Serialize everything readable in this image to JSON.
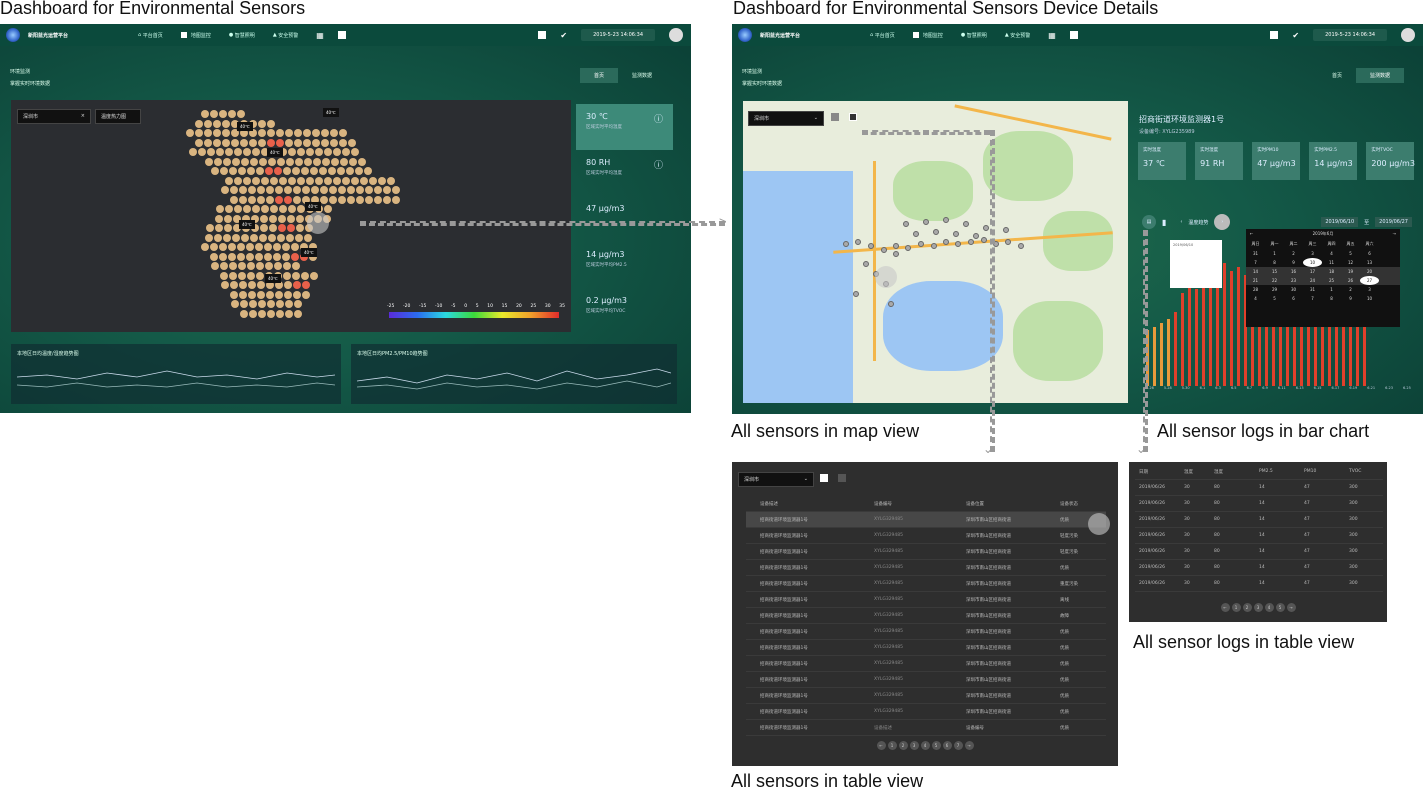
{
  "captions": {
    "dash_main": "Dashboard for Environmental Sensors",
    "dash_details": "Dashboard for Environmental Sensors Device Details",
    "map_view": "All sensors in map view",
    "bar_chart": "All sensor logs in bar chart",
    "table_view": "All sensors in table view",
    "logs_table": "All sensor logs in table view"
  },
  "topbar": {
    "brand": "新阳蓝光运营平台",
    "nav": [
      "平台首页",
      "地图监控",
      "智慧照明",
      "安全预警"
    ],
    "date": "2019-5-23 14:06:34"
  },
  "left": {
    "title": "环境监测",
    "subtitle": "掌握实时环境数据",
    "tabs": [
      "首页",
      "监测数据"
    ],
    "city": "深圳市",
    "layer": "温度热力图",
    "tags": [
      "40℃",
      "40℃",
      "40℃",
      "40℃",
      "40℃",
      "40℃",
      "40℃"
    ],
    "stats": [
      {
        "value": "30 ℃",
        "label": "区域实时平均温度"
      },
      {
        "value": "80 RH",
        "label": "区域实时平均湿度"
      },
      {
        "value": "47 μg/m3",
        "label": ""
      },
      {
        "value": "14 μg/m3",
        "label": "区域实时平均PM2.5"
      },
      {
        "value": "0.2 μg/m3",
        "label": "区域实时平均TVOC"
      }
    ],
    "scale": [
      "-25",
      "-20",
      "-15",
      "-10",
      "-5",
      "0",
      "5",
      "10",
      "15",
      "20",
      "25",
      "30",
      "35"
    ],
    "charts": [
      "本地区日均温度/湿度趋势图",
      "本地区日均PM2.5/PM10趋势图"
    ]
  },
  "right": {
    "tabs": [
      "首页",
      "监测数据"
    ],
    "city": "深圳市",
    "device_name": "招商街道环境监测器1号",
    "device_id": "设备编号: XYLG235989",
    "cards": [
      {
        "label": "实时温度",
        "value": "37 ℃"
      },
      {
        "label": "实时湿度",
        "value": "91 RH"
      },
      {
        "label": "实时PM10",
        "value": "47 μg/m3"
      },
      {
        "label": "实时PM2.5",
        "value": "14 μg/m3"
      },
      {
        "label": "实时TVOC",
        "value": "200 μg/m3"
      }
    ],
    "trend_label": "温度趋势",
    "date_from": "2019/06/10",
    "date_to": "2019/06/27",
    "to_sep": "至",
    "calendar_title": "2019年6月",
    "weekdays": [
      "周日",
      "周一",
      "周二",
      "周三",
      "周四",
      "周五",
      "周六"
    ],
    "calendar": [
      [
        "31",
        "1",
        "2",
        "3",
        "4",
        "5",
        "6"
      ],
      [
        "7",
        "8",
        "9",
        "10",
        "11",
        "12",
        "13"
      ],
      [
        "14",
        "15",
        "16",
        "17",
        "18",
        "19",
        "20"
      ],
      [
        "21",
        "22",
        "23",
        "24",
        "25",
        "26",
        "27"
      ],
      [
        "28",
        "29",
        "30",
        "31",
        "1",
        "2",
        "3"
      ],
      [
        "4",
        "5",
        "6",
        "7",
        "8",
        "9",
        "10"
      ]
    ],
    "xticks": [
      "5.26",
      "5.28",
      "5.30",
      "6.1",
      "6.3",
      "6.5",
      "6.7",
      "6.9",
      "6.11",
      "6.13",
      "6.15",
      "6.17",
      "6.19",
      "6.21",
      "6.23",
      "6.25"
    ],
    "bar_values": [
      30,
      32,
      34,
      36,
      40,
      50,
      58,
      52,
      60,
      62,
      64,
      66,
      62,
      64,
      60,
      58,
      62,
      66,
      64,
      62,
      60,
      64,
      66,
      62,
      64,
      66,
      60,
      62,
      64,
      66,
      62,
      64
    ]
  },
  "sensor_table": {
    "city": "深圳市",
    "headers": [
      "设备描述",
      "设备编号",
      "设备位置",
      "设备状态"
    ],
    "rows": [
      [
        "招商街道环境监测器1号",
        "XYLG329485",
        "深圳市南山区招商街道",
        "优质"
      ],
      [
        "招商街道环境监测器1号",
        "XYLG329485",
        "深圳市南山区招商街道",
        "轻度污染"
      ],
      [
        "招商街道环境监测器1号",
        "XYLG329485",
        "深圳市南山区招商街道",
        "轻度污染"
      ],
      [
        "招商街道环境监测器1号",
        "XYLG329485",
        "深圳市南山区招商街道",
        "优质"
      ],
      [
        "招商街道环境监测器1号",
        "XYLG329485",
        "深圳市南山区招商街道",
        "重度污染"
      ],
      [
        "招商街道环境监测器1号",
        "XYLG329485",
        "深圳市南山区招商街道",
        "离线"
      ],
      [
        "招商街道环境监测器1号",
        "XYLG329485",
        "深圳市南山区招商街道",
        "故障"
      ],
      [
        "招商街道环境监测器1号",
        "XYLG329485",
        "深圳市南山区招商街道",
        "优质"
      ],
      [
        "招商街道环境监测器1号",
        "XYLG329485",
        "深圳市南山区招商街道",
        "优质"
      ],
      [
        "招商街道环境监测器1号",
        "XYLG329485",
        "深圳市南山区招商街道",
        "优质"
      ],
      [
        "招商街道环境监测器1号",
        "XYLG329485",
        "深圳市南山区招商街道",
        "优质"
      ],
      [
        "招商街道环境监测器1号",
        "XYLG329485",
        "深圳市南山区招商街道",
        "优质"
      ],
      [
        "招商街道环境监测器1号",
        "XYLG329485",
        "深圳市南山区招商街道",
        "优质"
      ],
      [
        "招商街道环境监测器1号",
        "设备描述",
        "设备编号",
        "优质"
      ]
    ],
    "pages": [
      "←",
      "1",
      "2",
      "3",
      "4",
      "5",
      "6",
      "7",
      "→"
    ]
  },
  "log_table": {
    "headers": [
      "日期",
      "温度",
      "湿度",
      "PM2.5",
      "PM10",
      "TVOC"
    ],
    "rows": [
      [
        "2019/06/26",
        "30",
        "80",
        "14",
        "47",
        "300"
      ],
      [
        "2019/06/26",
        "30",
        "80",
        "14",
        "47",
        "300"
      ],
      [
        "2019/06/26",
        "30",
        "80",
        "14",
        "47",
        "300"
      ],
      [
        "2019/06/26",
        "30",
        "80",
        "14",
        "47",
        "300"
      ],
      [
        "2019/06/26",
        "30",
        "80",
        "14",
        "47",
        "300"
      ],
      [
        "2019/06/26",
        "30",
        "80",
        "14",
        "47",
        "300"
      ],
      [
        "2019/06/26",
        "30",
        "80",
        "14",
        "47",
        "300"
      ]
    ],
    "pages": [
      "←",
      "1",
      "2",
      "3",
      "4",
      "5",
      "→"
    ]
  }
}
